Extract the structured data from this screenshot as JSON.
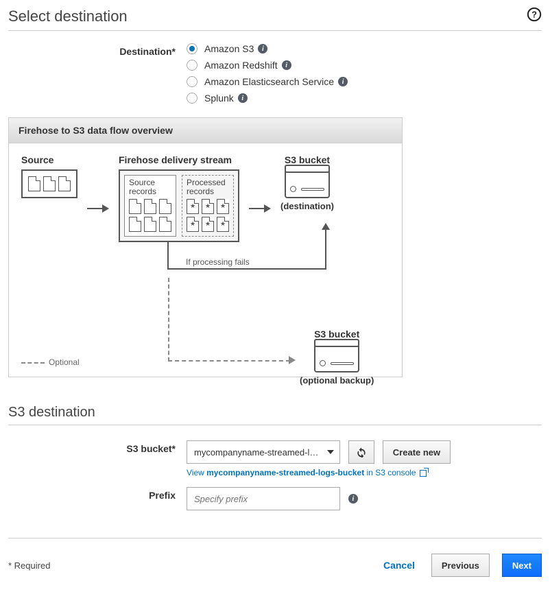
{
  "header": {
    "title": "Select destination"
  },
  "destination": {
    "label": "Destination*",
    "options": [
      {
        "label": "Amazon S3",
        "checked": true
      },
      {
        "label": "Amazon Redshift",
        "checked": false
      },
      {
        "label": "Amazon Elasticsearch Service",
        "checked": false
      },
      {
        "label": "Splunk",
        "checked": false
      }
    ]
  },
  "diagram": {
    "title": "Firehose to S3 data flow overview",
    "source_label": "Source",
    "fds_label": "Firehose delivery stream",
    "source_records": "Source records",
    "processed_records": "Processed records",
    "s3_label": "S3 bucket",
    "destination_caption": "(destination)",
    "fail_text": "If processing fails",
    "backup_caption": "(optional backup)",
    "legend": "Optional"
  },
  "s3dest": {
    "heading": "S3 destination",
    "bucket_label": "S3 bucket*",
    "bucket_value": "mycompanyname-streamed-log…",
    "create_new": "Create new",
    "view_prefix": "View ",
    "view_bucket": "mycompanyname-streamed-logs-bucket",
    "view_suffix": " in S3 console",
    "prefix_label": "Prefix",
    "prefix_placeholder": "Specify prefix"
  },
  "footer": {
    "required": "* Required",
    "cancel": "Cancel",
    "previous": "Previous",
    "next": "Next"
  }
}
